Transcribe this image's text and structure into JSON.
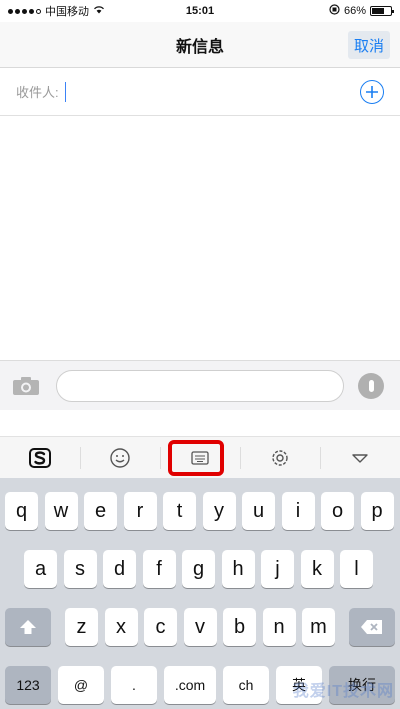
{
  "status_bar": {
    "carrier": "中国移动",
    "time": "15:01",
    "battery": "66%",
    "battery_level": 0.66
  },
  "nav": {
    "title": "新信息",
    "cancel_label": "取消"
  },
  "recipient": {
    "label": "收件人:"
  },
  "keyboard": {
    "row1": [
      "q",
      "w",
      "e",
      "r",
      "t",
      "y",
      "u",
      "i",
      "o",
      "p"
    ],
    "row2": [
      "a",
      "s",
      "d",
      "f",
      "g",
      "h",
      "j",
      "k",
      "l"
    ],
    "row3": [
      "z",
      "x",
      "c",
      "v",
      "b",
      "n",
      "m"
    ],
    "row1_hints": [
      "",
      "",
      "",
      "",
      "",
      "",
      "",
      "",
      "",
      ""
    ],
    "row2_hints": [
      "",
      "",
      "",
      "",
      "",
      "",
      "",
      "",
      "",
      ""
    ],
    "bottom": {
      "numbers": "123",
      "at": "@",
      "dot": ".",
      "com": ".com",
      "ch": "ch",
      "en": "英",
      "return": "换行"
    }
  },
  "watermark": "我爱IT技术网",
  "colors": {
    "accent": "#1a7ef2",
    "highlight": "#e00000",
    "keyboard_bg": "#d4d8de"
  }
}
